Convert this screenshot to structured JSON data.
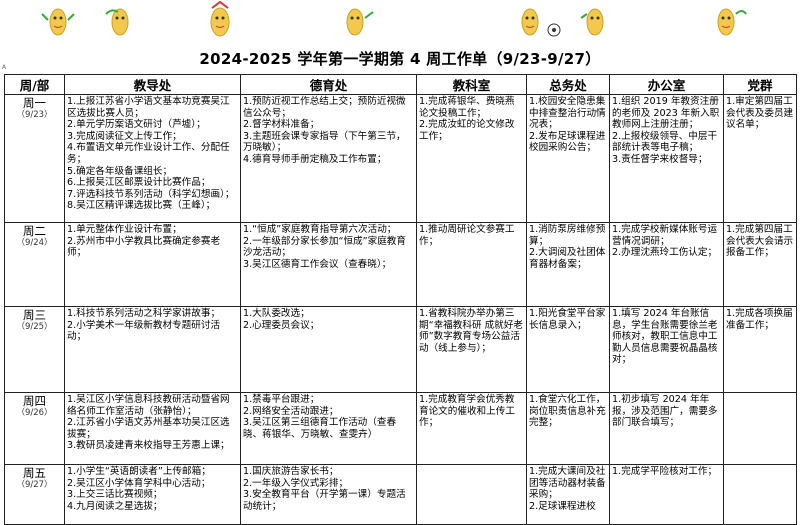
{
  "title": "2024-2025 学年第一学期第 4 周工作单（9/23-9/27）",
  "corner_mark": "A",
  "headers": [
    "周/部",
    "教导处",
    "德育处",
    "教科室",
    "总务处",
    "办公室",
    "党群"
  ],
  "rows": [
    {
      "day": "周一",
      "date": "（9/23）",
      "cells": [
        [
          "1.上报江苏省小学语文基本功竞赛吴江区选拔比赛人员；",
          "2.单元学历案语文研讨（芦墟）；",
          "3.完成阅读征文上传工作；",
          "4.布置语文单元作业设计工作、分配任务；",
          "5.确定各年级备课组长；",
          "6.上报吴江区邮票设计比赛作品；",
          "7.评选科技节系列活动（科学幻想画）；",
          "8.吴江区精评课选拔比赛（王峰）；"
        ],
        [
          "1.预防近视工作总结上交；预防近视微信公众号；",
          "2.督学材料准备；",
          "3.主题班会课专家指导（下午第三节，万晓敏）；",
          "4.德育导师手册定稿及工作布置；"
        ],
        [
          "1.完成蒋银华、费晓燕论文投稿工作；",
          "2.完成汝虹的论文修改工作；"
        ],
        [
          "1.校园安全隐患集中排查整治行动情况表；",
          "2.发布足球课程进校园采购公告；"
        ],
        [
          "1.组织 2019 年教资注册的老师及 2023 年新入职教师网上注册注册；",
          "2.上报校级领导、中层干部统计表等电子稿；",
          "3.责任督学来校督导；"
        ],
        [
          "1.审定第四届工会代表及委员建议名单；"
        ]
      ]
    },
    {
      "day": "周二",
      "date": "（9/24）",
      "cells": [
        [
          "1.单元整体作业设计布置；",
          "2.苏州市中小学教具比赛确定参赛老师；"
        ],
        [
          "1.“恒成”家庭教育指导第六次活动；",
          "2.一年级部分家长参加“恒成”家庭教育沙龙活动；",
          "3.吴江区德育工作会议（查春晓）；"
        ],
        [
          "1.推动周研论文参赛工作；"
        ],
        [
          "1.消防泵房维修预算；",
          "2.大调阅及社团体育器材备案；"
        ],
        [
          "1.完成学校新媒体账号运营情况调研；",
          "2.办理沈燕玲工伤认定；"
        ],
        [
          "1.完成第四届工会代表大会请示报备工作；"
        ]
      ]
    },
    {
      "day": "周三",
      "date": "（9/25）",
      "cells": [
        [
          "1.科技节系列活动之科学家讲故事；",
          "2.小学美术一年级新教材专题研讨活动；"
        ],
        [
          "1.大队委改选；",
          "2.心理委员会议；"
        ],
        [
          "1.省教科院办举办第三期“幸福教科研 成就好老师”数字教育专场公益活动（线上参与）；"
        ],
        [
          "1.阳光食堂平台家长信息录入；"
        ],
        [
          "1.填写 2024 年台账信息，学生台账需要徐兰老师核对，教职工信息中工勤人员信息需要祝晶晶核对；"
        ],
        [
          "1.完成各项换届准备工作；"
        ]
      ]
    },
    {
      "day": "周四",
      "date": "（9/26）",
      "cells": [
        [
          "1.吴江区小学信息科技教研活动暨省网络名师工作室活动（张静怡）；",
          "2.江苏省小学语文苏州基本功吴江区选拔赛；",
          "3.教研员凌建青来校指导王芳惠上课；"
        ],
        [
          "1.禁毒平台跟进；",
          "2.网络安全活动跟进；",
          "3.吴江区第三组德育工作活动（查春晓、蒋银华、万晓敏、查雯卉）"
        ],
        [
          "1.完成教育学会优秀教育论文的催收和上传工作；"
        ],
        [
          "1.食堂六化工作，岗位职责信息补充完整；"
        ],
        [
          "1.初步填写 2024 年年报，涉及范围广，需要多部门联合填写；"
        ],
        [
          ""
        ]
      ]
    },
    {
      "day": "周五",
      "date": "（9/27）",
      "cells": [
        [
          "1.小学生“英语朗读者”上传邮箱；",
          "2.吴江区小学体育学科中心活动；",
          "3.上交三话比赛视频；",
          "4.九月阅读之星选拔；"
        ],
        [
          "1.国庆旅游告家长书；",
          "2.一年级入学仪式彩排；",
          "3.安全教育平台（开学第一课）专题活动统计；"
        ],
        [
          ""
        ],
        [
          "1.完成大课间及社团等活动器材装备采购；",
          "2.足球课程进校"
        ],
        [
          "1.完成学平险核对工作；"
        ],
        [
          ""
        ]
      ]
    }
  ]
}
